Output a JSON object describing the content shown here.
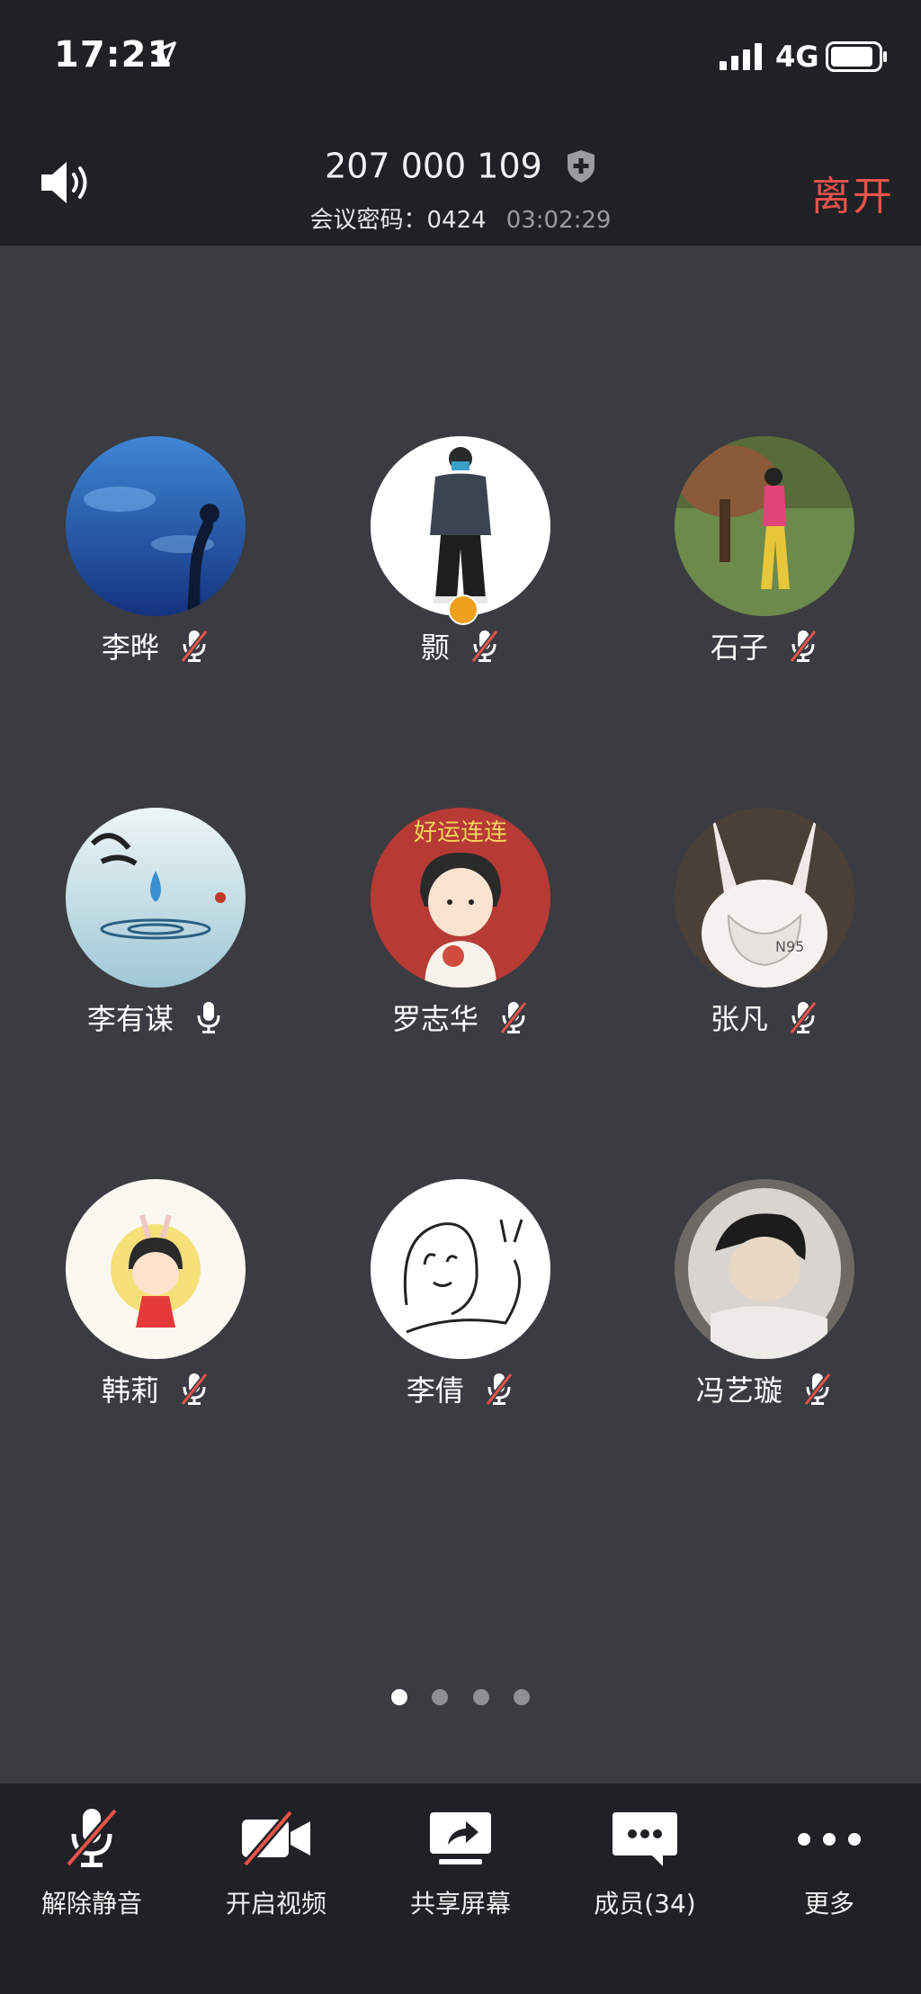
{
  "status_bar": {
    "time": "17:21",
    "network": "4G"
  },
  "header": {
    "meeting_id": "207 000 109",
    "password_label": "会议密码：",
    "password_value": "0424",
    "elapsed": "03:02:29",
    "leave_label": "离开"
  },
  "participants": [
    {
      "name": "李晔",
      "mic": "muted",
      "avatar": "aquarium-photo"
    },
    {
      "name": "颢",
      "mic": "muted",
      "avatar": "man-standing-photo",
      "host": true
    },
    {
      "name": "石子",
      "mic": "muted",
      "avatar": "girl-outdoors-photo"
    },
    {
      "name": "李有谋",
      "mic": "on",
      "avatar": "water-drop-calligraphy"
    },
    {
      "name": "罗志华",
      "mic": "muted",
      "avatar": "cartoon-boy-red",
      "avatar_text": "好运连连"
    },
    {
      "name": "张凡",
      "mic": "muted",
      "avatar": "rabbit-mask"
    },
    {
      "name": "韩莉",
      "mic": "muted",
      "avatar": "cartoon-girl"
    },
    {
      "name": "李倩",
      "mic": "muted",
      "avatar": "line-drawing-girl"
    },
    {
      "name": "冯艺璇",
      "mic": "muted",
      "avatar": "anime-astronaut"
    }
  ],
  "pagination": {
    "pages": 4,
    "current": 1
  },
  "toolbar": [
    {
      "label": "解除静音",
      "icon": "mic-off-icon"
    },
    {
      "label": "开启视频",
      "icon": "video-off-icon"
    },
    {
      "label": "共享屏幕",
      "icon": "share-screen-icon"
    },
    {
      "label": "成员(34)",
      "icon": "members-chat-icon"
    },
    {
      "label": "更多",
      "icon": "more-icon"
    }
  ],
  "colors": {
    "leave": "#e8534c",
    "muted_slash": "#e8534c",
    "background": "#3a3c41",
    "bars": "#202124"
  }
}
